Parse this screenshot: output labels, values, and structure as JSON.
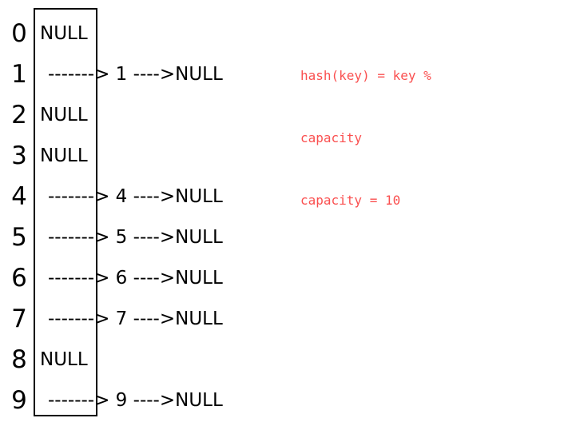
{
  "diagram": {
    "title": "hash-table-separate-chaining",
    "box": {
      "capacity": 10
    },
    "buckets": [
      {
        "index": "0",
        "empty": true,
        "value": "NULL",
        "link1": "",
        "key": "",
        "link2": "",
        "terminator": ""
      },
      {
        "index": "1",
        "empty": false,
        "value": "",
        "link1": "------->",
        "key": " 1",
        "link2": " ---->",
        "terminator": "NULL"
      },
      {
        "index": "2",
        "empty": true,
        "value": "NULL",
        "link1": "",
        "key": "",
        "link2": "",
        "terminator": ""
      },
      {
        "index": "3",
        "empty": true,
        "value": "NULL",
        "link1": "",
        "key": "",
        "link2": "",
        "terminator": ""
      },
      {
        "index": "4",
        "empty": false,
        "value": "",
        "link1": "------->",
        "key": " 4",
        "link2": " ---->",
        "terminator": "NULL"
      },
      {
        "index": "5",
        "empty": false,
        "value": "",
        "link1": "------->",
        "key": " 5",
        "link2": " ---->",
        "terminator": "NULL"
      },
      {
        "index": "6",
        "empty": false,
        "value": "",
        "link1": "------->",
        "key": " 6",
        "link2": " ---->",
        "terminator": "NULL"
      },
      {
        "index": "7",
        "empty": false,
        "value": "",
        "link1": "------->",
        "key": " 7",
        "link2": " ---->",
        "terminator": "NULL"
      },
      {
        "index": "8",
        "empty": true,
        "value": "NULL",
        "link1": "",
        "key": "",
        "link2": "",
        "terminator": ""
      },
      {
        "index": "9",
        "empty": false,
        "value": "",
        "link1": "------->",
        "key": " 9",
        "link2": " ---->",
        "terminator": "NULL"
      }
    ]
  },
  "annotation": {
    "color": "#fa5050",
    "lines": [
      "hash(key) = key %",
      "capacity",
      "capacity = 10"
    ]
  }
}
